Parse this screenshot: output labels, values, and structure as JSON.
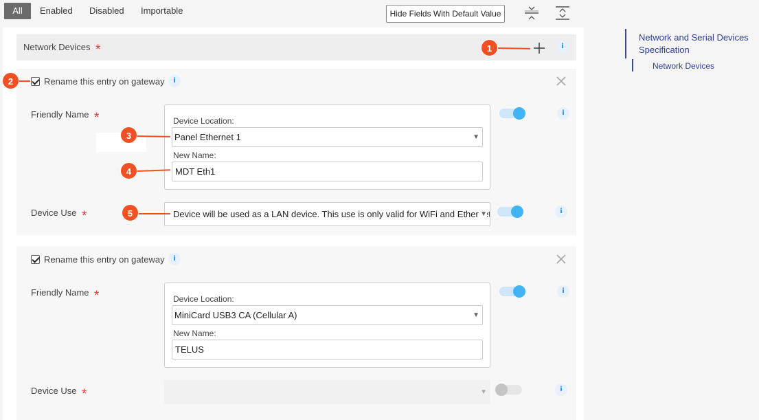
{
  "tabs": [
    {
      "label": "All",
      "active": true
    },
    {
      "label": "Enabled",
      "active": false
    },
    {
      "label": "Disabled",
      "active": false
    },
    {
      "label": "Importable",
      "active": false
    }
  ],
  "toolbar": {
    "hide_defaults_label": "Hide Fields With Default Value",
    "collapse_icon": "collapse-all-icon",
    "expand_icon": "expand-all-icon"
  },
  "section": {
    "title": "Network Devices",
    "required_mark": "*",
    "add_icon": "plus-icon",
    "info_icon": "i"
  },
  "entries": [
    {
      "rename_label": "Rename this entry on gateway",
      "rename_checked": true,
      "friendly_name_label": "Friendly Name",
      "device_location_label": "Device Location:",
      "device_location_value": "Panel Ethernet 1",
      "new_name_label": "New Name:",
      "new_name_value": "MDT Eth1",
      "friendly_toggle": "on",
      "device_use_label": "Device Use",
      "device_use_value": "Device will be used as a LAN device. This use is only valid for WiFi and Ethernet",
      "device_use_toggle": "on"
    },
    {
      "rename_label": "Rename this entry on gateway",
      "rename_checked": true,
      "friendly_name_label": "Friendly Name",
      "device_location_label": "Device Location:",
      "device_location_value": "MiniCard USB3 CA (Cellular A)",
      "new_name_label": "New Name:",
      "new_name_value": "TELUS",
      "friendly_toggle": "on",
      "device_use_label": "Device Use",
      "device_use_value": "",
      "device_use_toggle": "off"
    }
  ],
  "callouts": [
    "1",
    "2",
    "3",
    "4",
    "5"
  ],
  "toc": {
    "title": "Network and Serial Devices Specification",
    "items": [
      "Network Devices"
    ]
  },
  "colors": {
    "accent": "#f25022",
    "toggle_on": "#42b4f5",
    "required": "#e53935",
    "toc_link": "#2c3e8f"
  }
}
